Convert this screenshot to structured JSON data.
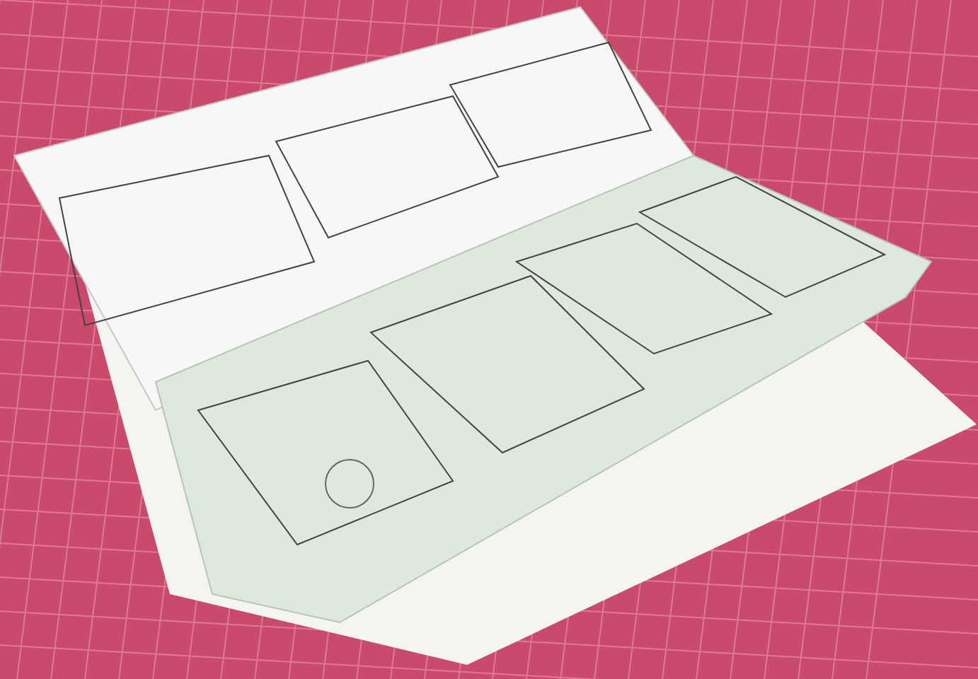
{
  "photo": {
    "kind": "sketchbook"
  }
}
